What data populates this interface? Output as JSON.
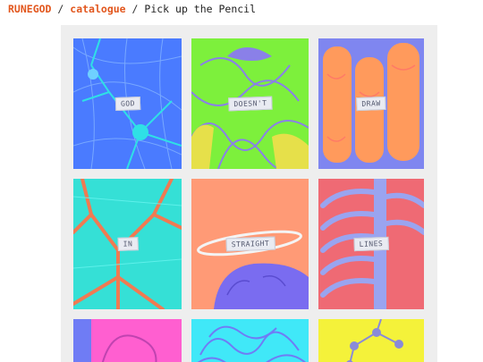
{
  "breadcrumb": {
    "site": "RUNEGOD",
    "separator1": "/",
    "section": "catalogue",
    "separator2": "/",
    "title": "Pick up the Pencil"
  },
  "panels": [
    {
      "word": "GOD",
      "bg": "#4a7bff",
      "accent": "#2fe0e6"
    },
    {
      "word": "DOESN'T",
      "bg": "#7df03c",
      "accent": "#8a80e8"
    },
    {
      "word": "DRAW",
      "bg": "#7f86f0",
      "accent": "#ff9a5c"
    },
    {
      "word": "IN",
      "bg": "#35e0d6",
      "accent": "#f07a52"
    },
    {
      "word": "STRAIGHT",
      "bg": "#ff9a76",
      "accent": "#7a6cf0"
    },
    {
      "word": "LINES",
      "bg": "#ef6a74",
      "accent": "#9aa4f0"
    }
  ],
  "colors": {
    "link": "#e2571e",
    "board": "#eeeeee"
  }
}
